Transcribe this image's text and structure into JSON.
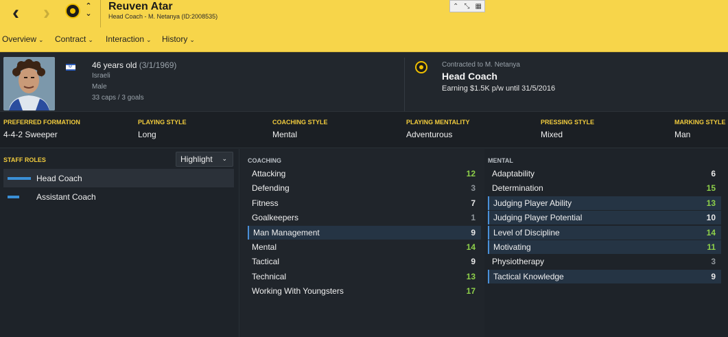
{
  "header": {
    "name": "Reuven Atar",
    "subtitle": "Head Coach - M. Netanya (ID:2008535)"
  },
  "tabs": [
    {
      "label": "Overview"
    },
    {
      "label": "Contract"
    },
    {
      "label": "Interaction"
    },
    {
      "label": "History"
    }
  ],
  "profile": {
    "age": "46 years old",
    "dob": "(3/1/1969)",
    "nationality": "Israeli",
    "gender": "Male",
    "caps": "33 caps / 3 goals"
  },
  "contract": {
    "to": "Contracted to M. Netanya",
    "role": "Head Coach",
    "earning": "Earning $1.5K p/w until 31/5/2016"
  },
  "styles": [
    {
      "label": "PREFERRED FORMATION",
      "value": "4-4-2 Sweeper"
    },
    {
      "label": "PLAYING STYLE",
      "value": "Long"
    },
    {
      "label": "COACHING STYLE",
      "value": "Mental"
    },
    {
      "label": "PLAYING MENTALITY",
      "value": "Adventurous"
    },
    {
      "label": "PRESSING STYLE",
      "value": "Mixed"
    },
    {
      "label": "MARKING STYLE",
      "value": "Man"
    }
  ],
  "roles": {
    "title": "STAFF ROLES",
    "highlight": "Highlight",
    "items": [
      {
        "label": "Head Coach",
        "bar": 1.0
      },
      {
        "label": "Assistant Coach",
        "bar": 0.5
      }
    ]
  },
  "coaching": {
    "title": "COACHING",
    "items": [
      {
        "name": "Attacking",
        "value": "12"
      },
      {
        "name": "Defending",
        "value": "3"
      },
      {
        "name": "Fitness",
        "value": "7"
      },
      {
        "name": "Goalkeepers",
        "value": "1"
      },
      {
        "name": "Man Management",
        "value": "9"
      },
      {
        "name": "Mental",
        "value": "14"
      },
      {
        "name": "Tactical",
        "value": "9"
      },
      {
        "name": "Technical",
        "value": "13"
      },
      {
        "name": "Working With Youngsters",
        "value": "17"
      }
    ]
  },
  "mental": {
    "title": "MENTAL",
    "items": [
      {
        "name": "Adaptability",
        "value": "6"
      },
      {
        "name": "Determination",
        "value": "15"
      },
      {
        "name": "Judging Player Ability",
        "value": "13"
      },
      {
        "name": "Judging Player Potential",
        "value": "10"
      },
      {
        "name": "Level of Discipline",
        "value": "14"
      },
      {
        "name": "Motivating",
        "value": "11"
      },
      {
        "name": "Physiotherapy",
        "value": "3"
      },
      {
        "name": "Tactical Knowledge",
        "value": "9"
      }
    ]
  }
}
